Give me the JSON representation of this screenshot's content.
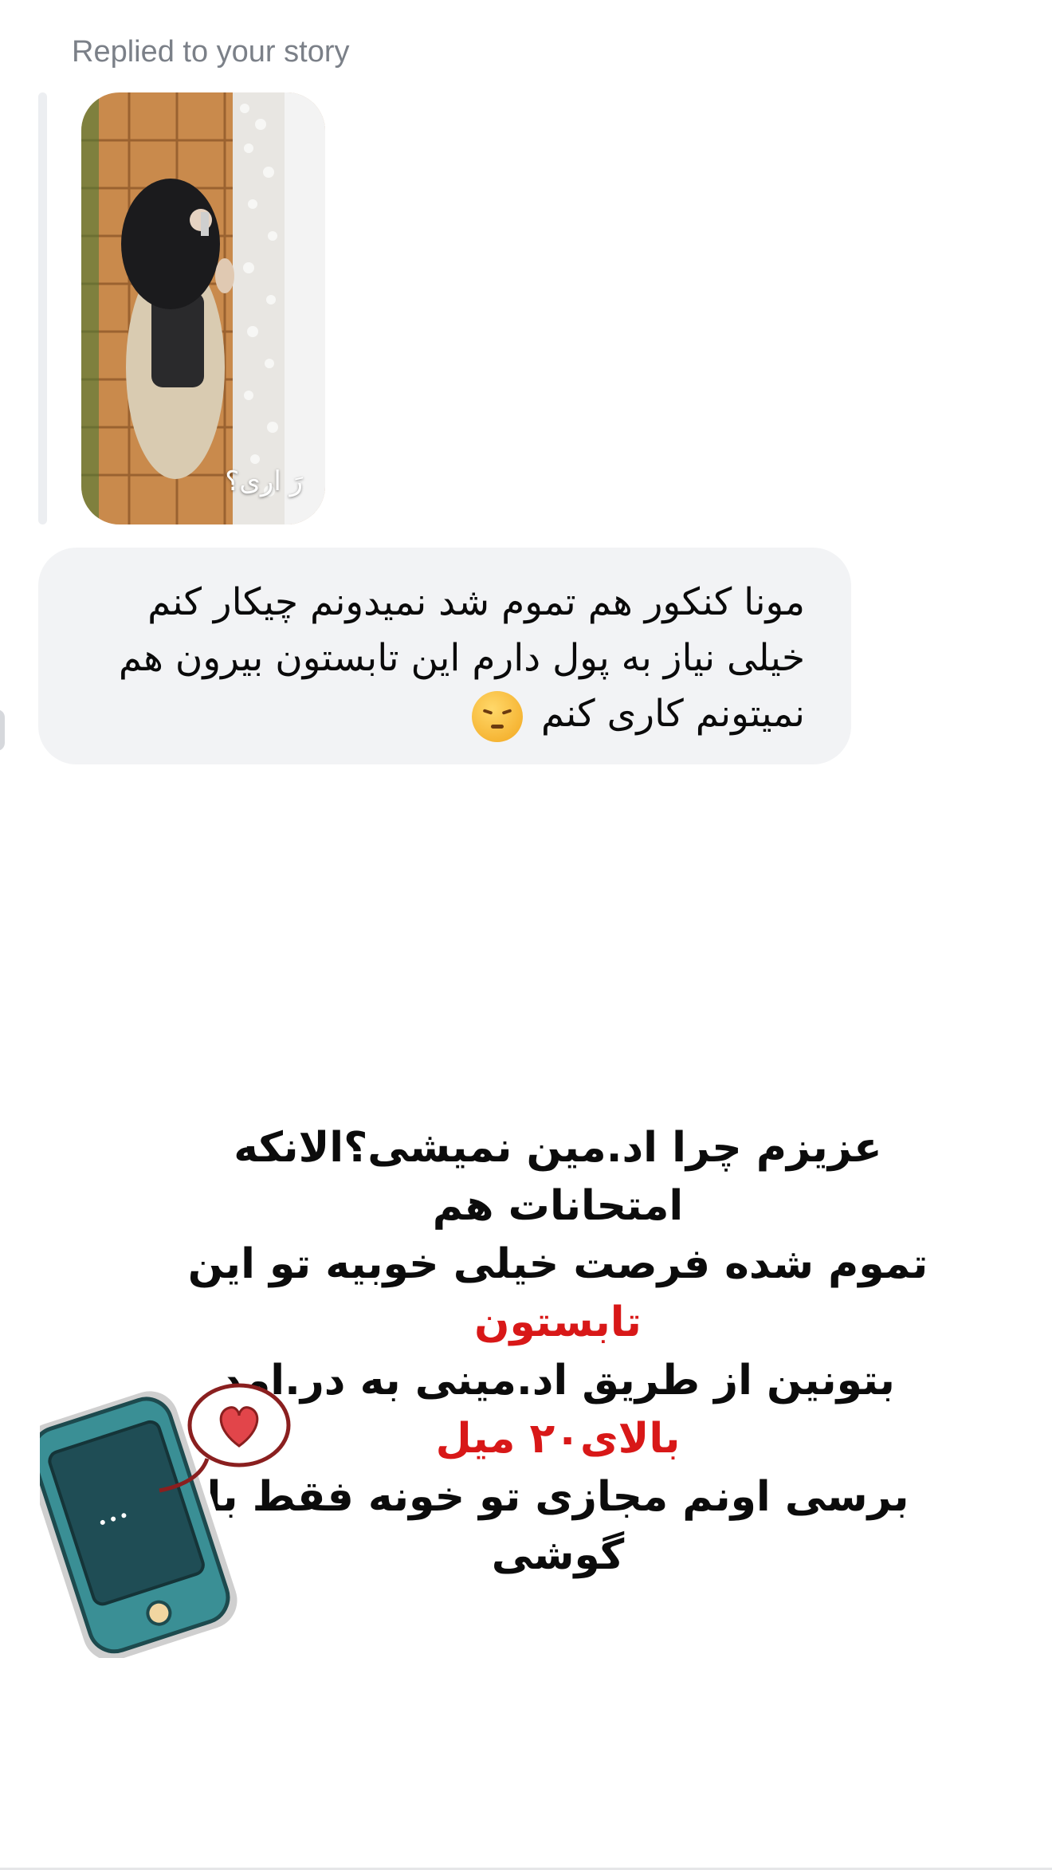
{
  "reply": {
    "label": "Replied to your story",
    "story_caption": "رَ اری؟"
  },
  "message": {
    "line1": "مونا کنکور هم تموم شد نمیدونم چیکار کنم",
    "line2": "خیلی نیاز به پول دارم این تابستون بیرون هم",
    "line3": "نمیتونم کاری کنم",
    "emoji": "pensive-face-emoji"
  },
  "overlay": {
    "line1": "عزیزم چرا اد.مین نمیشی؟الانکه امتحانات هم",
    "line2_a": "تموم شده فرصت خیلی خوبیه تو این ",
    "line2_b": "تابستون",
    "line3_a": "بتونین از طریق اد.مینی به در.امد ",
    "line3_b": "بالای۲۰ میل",
    "line4": "برسی اونم مجازی تو خونه فقط با گوشی"
  },
  "colors": {
    "bubble": "#f2f3f5",
    "highlight": "#d81818",
    "label": "#7b8088"
  },
  "icons": {
    "sticker": "phone-heart-sticker"
  }
}
